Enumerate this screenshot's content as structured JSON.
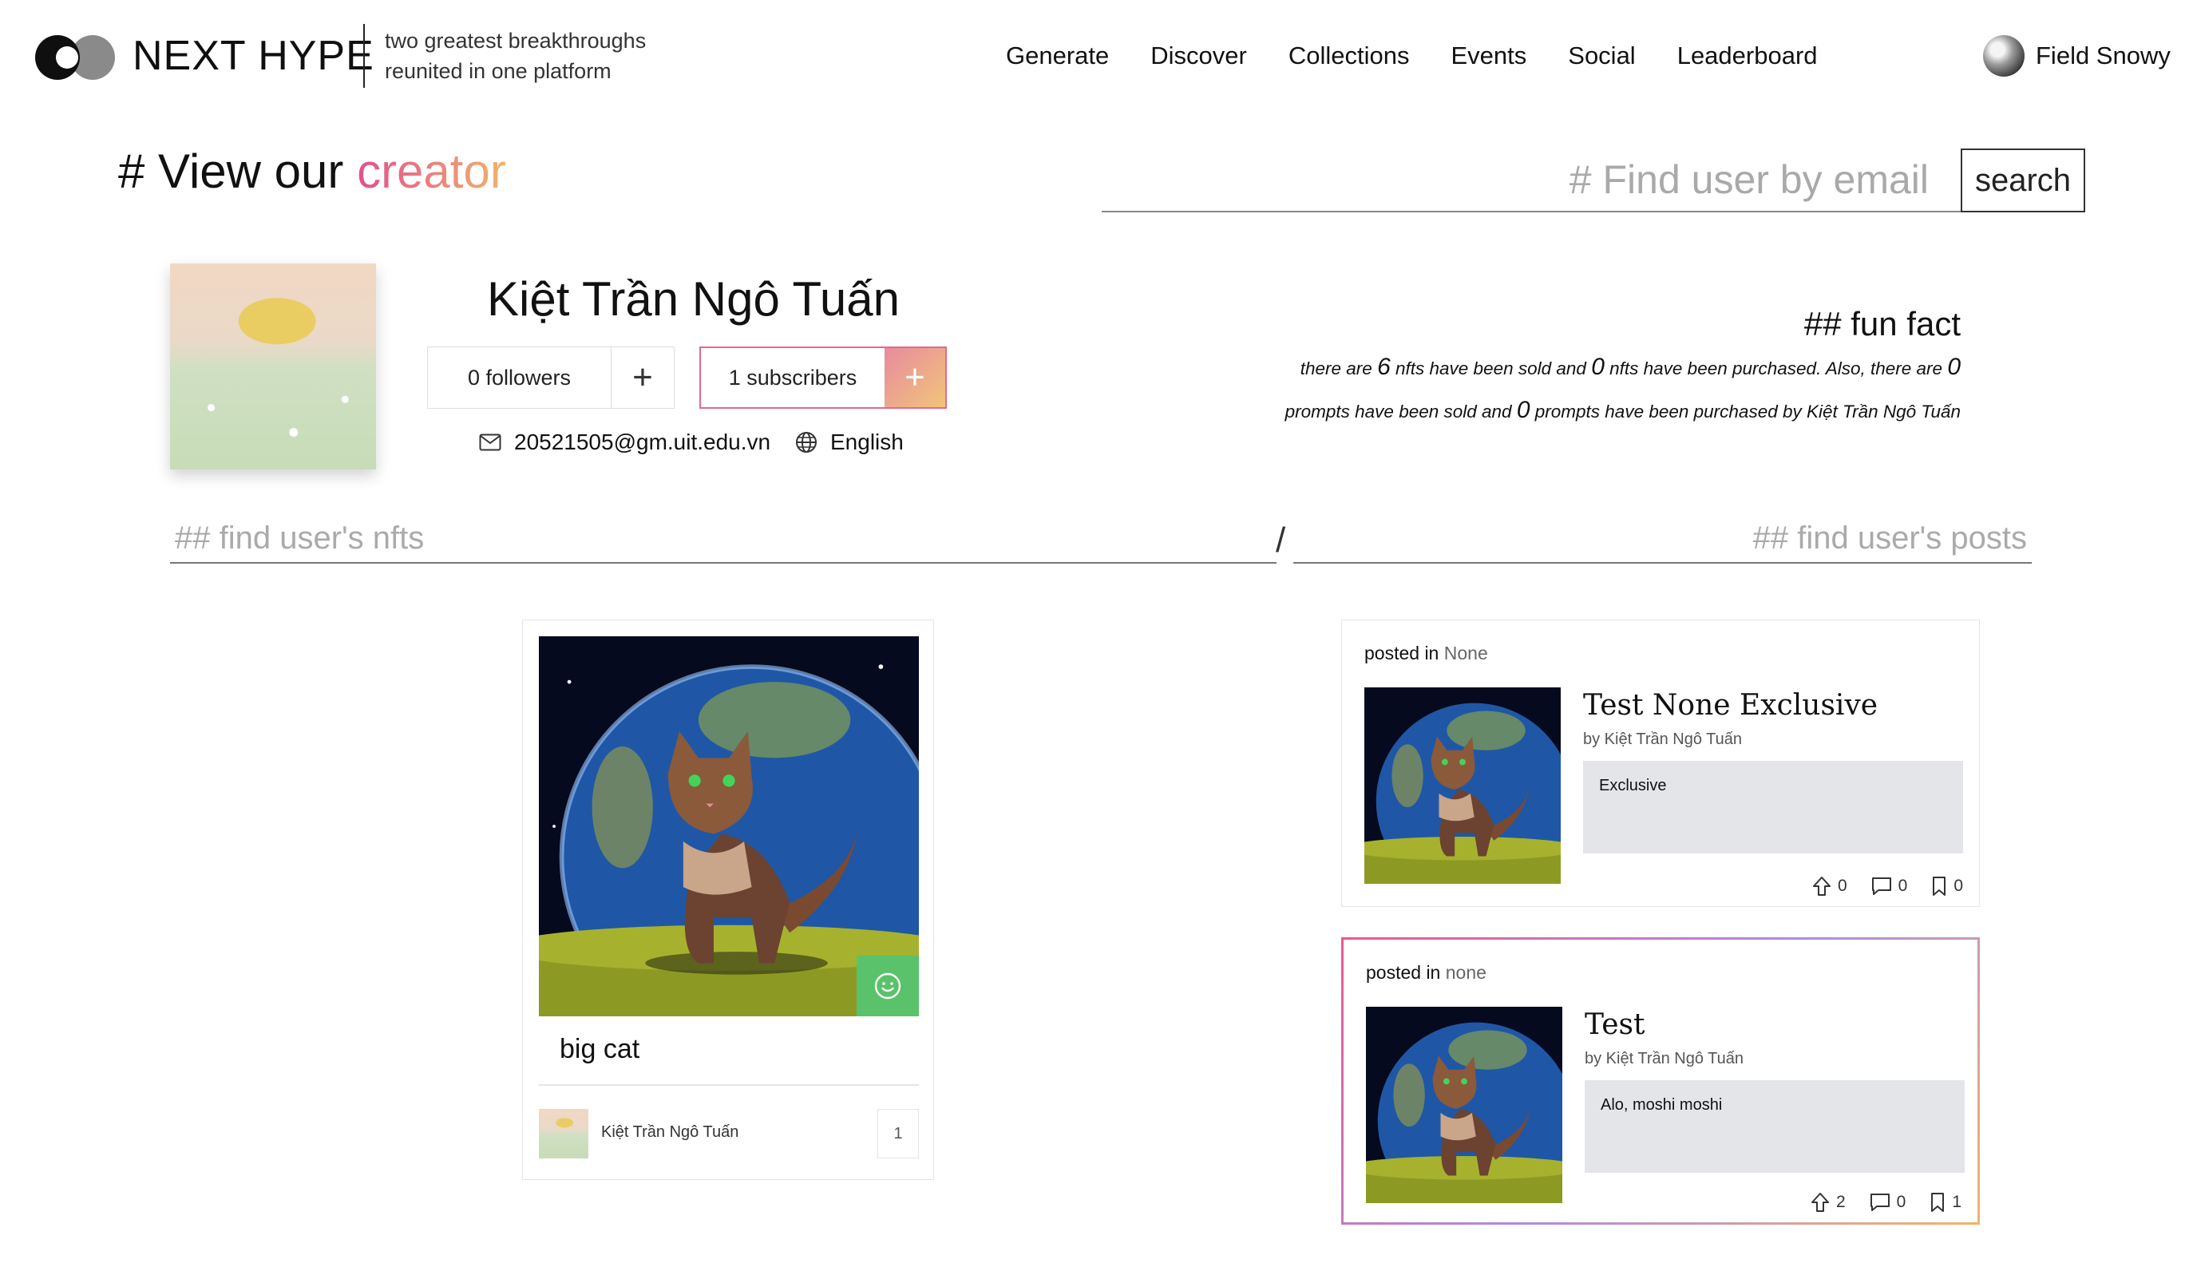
{
  "header": {
    "brand": "NEXT HYPE",
    "tagline_line1": "two greatest breakthroughs",
    "tagline_line2": "reunited in one platform",
    "nav": [
      "Generate",
      "Discover",
      "Collections",
      "Events",
      "Social",
      "Leaderboard"
    ],
    "user_name": "Field Snowy"
  },
  "page": {
    "title_prefix": "# View our ",
    "title_highlight": "creator"
  },
  "search": {
    "placeholder": "# Find user by email",
    "button_label": "search"
  },
  "profile": {
    "name": "Kiệt Trần Ngô Tuấn",
    "followers_label": "0 followers",
    "follow_button": "+",
    "subscribers_label": "1 subscribers",
    "subscribe_button": "+",
    "email": "20521505@gm.uit.edu.vn",
    "language": "English"
  },
  "fun_fact": {
    "title": "## fun fact",
    "t1": "there are ",
    "nfts_sold": "6",
    "t2": " nfts have been sold and ",
    "nfts_purchased": "0",
    "t3": " nfts have been purchased. Also, there are ",
    "prompts_sold": "0",
    "t4": " prompts have been sold and ",
    "prompts_purchased": "0",
    "t5": " prompts have been purchased by Kiệt Trần Ngô Tuấn"
  },
  "sections": {
    "nfts_header": "## find user's nfts",
    "separator": "/",
    "posts_header": "## find user's posts"
  },
  "nfts": [
    {
      "title": "big cat",
      "owner": "Kiệt Trần Ngô Tuấn",
      "count": "1",
      "badge_icon": "smile-icon",
      "badge_color": "#59c26b"
    }
  ],
  "posts": [
    {
      "posted_in_label": "posted in",
      "posted_in": "None",
      "title": "Test None Exclusive",
      "by": "by Kiệt Trần Ngô Tuấn",
      "body": "Exclusive",
      "upvotes": "0",
      "comments": "0",
      "bookmarks": "0"
    },
    {
      "posted_in_label": "posted in",
      "posted_in": "none",
      "title": "Test",
      "by": "by Kiệt Trần Ngô Tuấn",
      "body": "Alo, moshi moshi",
      "upvotes": "2",
      "comments": "0",
      "bookmarks": "1"
    }
  ],
  "colors": {
    "accent_gradient_start": "#e0508f",
    "accent_gradient_end": "#f2b36b",
    "badge_green": "#59c26b",
    "post_body_bg": "#e4e5e9"
  }
}
